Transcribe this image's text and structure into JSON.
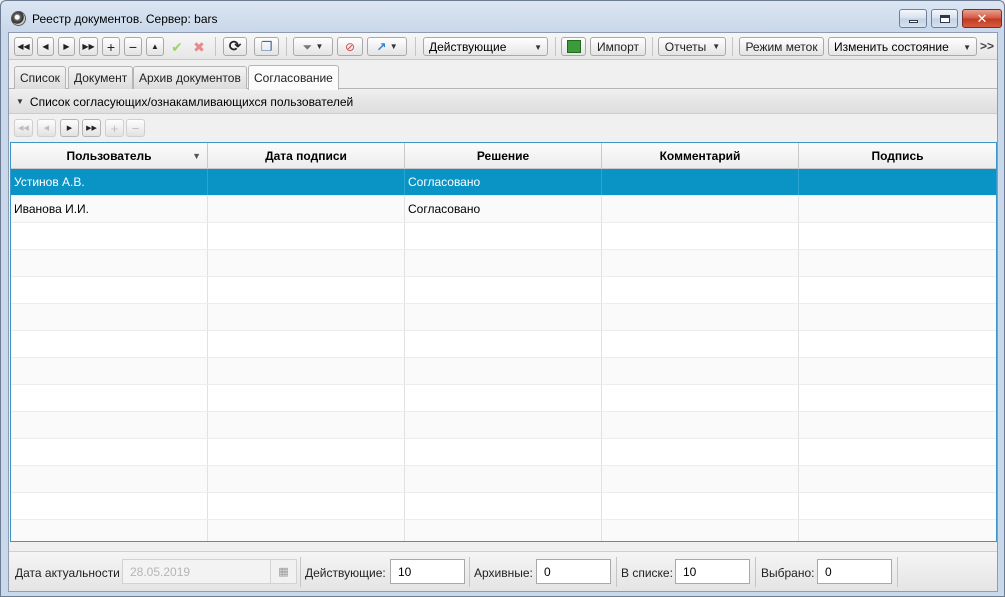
{
  "window": {
    "title": "Реестр документов. Сервер: bars"
  },
  "toolbar": {
    "nav_first": "first-record",
    "filter_combo": "Действующие",
    "import_label": "Импорт",
    "reports_label": "Отчеты",
    "tag_mode_label": "Режим меток",
    "change_state_label": "Изменить состояние",
    "more_label": ">>"
  },
  "tabs": [
    {
      "label": "Список"
    },
    {
      "label": "Документ"
    },
    {
      "label": "Архив документов"
    },
    {
      "label": "Согласование",
      "active": true
    }
  ],
  "section": {
    "title": "Список согласующих/ознакамливающихся пользователей"
  },
  "grid": {
    "columns": [
      "Пользователь",
      "Дата подписи",
      "Решение",
      "Комментарий",
      "Подпись"
    ],
    "rows": [
      [
        "Устинов А.В.",
        "",
        "Согласовано",
        "",
        ""
      ],
      [
        "Иванова И.И.",
        "",
        "Согласовано",
        "",
        ""
      ]
    ],
    "empty_rows": 12,
    "selected_row": 0
  },
  "status": {
    "date_label": "Дата актуальности",
    "date_value": "28.05.2019",
    "active_label": "Действующие:",
    "active_value": "10",
    "archive_label": "Архивные:",
    "archive_value": "0",
    "in_list_label": "В списке:",
    "in_list_value": "10",
    "selected_label": "Выбрано:",
    "selected_value": "0"
  },
  "colors": {
    "selection": "#0a93c5",
    "grid_border": "#3c97c8",
    "close_button": "#c03a22"
  }
}
